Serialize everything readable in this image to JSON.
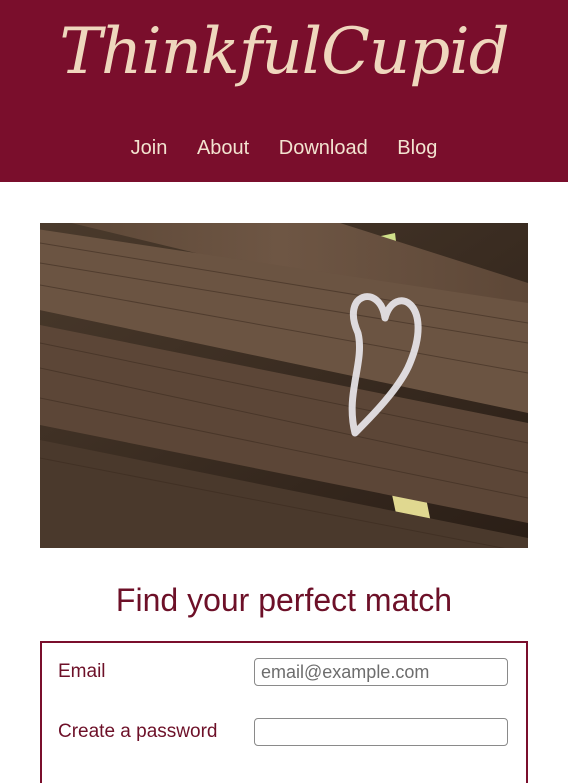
{
  "header": {
    "logo_text": "ThinkfulCupid",
    "nav": [
      {
        "label": "Join"
      },
      {
        "label": "About"
      },
      {
        "label": "Download"
      },
      {
        "label": "Blog"
      }
    ],
    "background_color": "#7a0e2c",
    "text_color": "#efd7bd"
  },
  "hero": {
    "image": "wooden-bench-chalk-heart"
  },
  "headline": "Find your perfect match",
  "form": {
    "email_label": "Email",
    "email_placeholder": "email@example.com",
    "password_label": "Create a password",
    "password_value": ""
  }
}
